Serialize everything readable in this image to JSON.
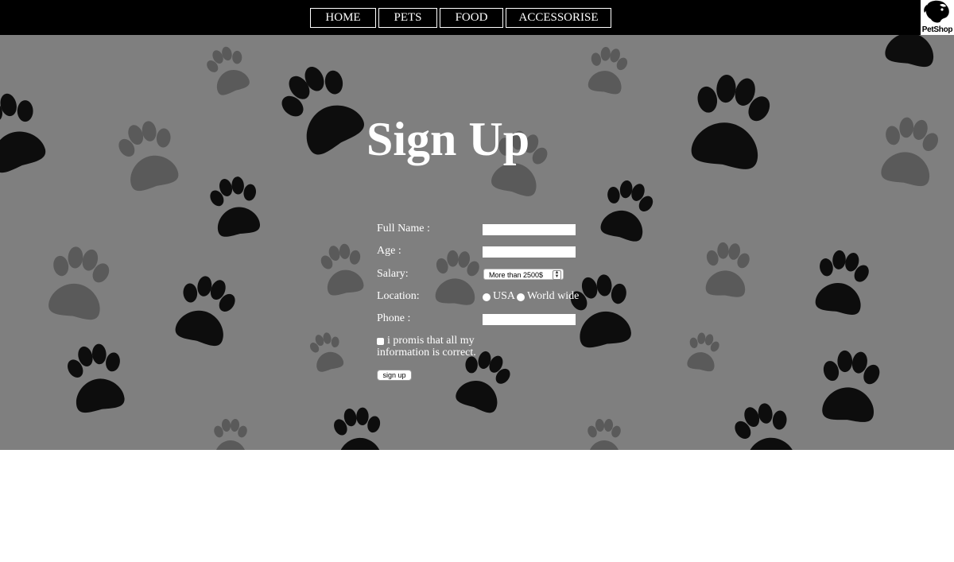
{
  "nav": {
    "items": [
      {
        "label": "HOME"
      },
      {
        "label": "PETS"
      },
      {
        "label": "FOOD"
      },
      {
        "label": "ACCESSORISE"
      }
    ]
  },
  "logo": {
    "text": "PetShop"
  },
  "page": {
    "title": "Sign Up"
  },
  "form": {
    "full_name_label": "Full Name :",
    "age_label": "Age :",
    "salary_label": "Salary:",
    "salary_selected": "More than 2500$",
    "location_label": "Location:",
    "location_options": [
      "USA",
      "World wide"
    ],
    "phone_label": "Phone :",
    "agree_line1": "i promis that all my",
    "agree_line2": "information is correct.",
    "submit_label": "sign up"
  },
  "colors": {
    "topbar": "#000000",
    "hero_background": "#7f7f7f",
    "paw_dark": "#0a0a0a",
    "paw_light": "#5a5a5a"
  }
}
